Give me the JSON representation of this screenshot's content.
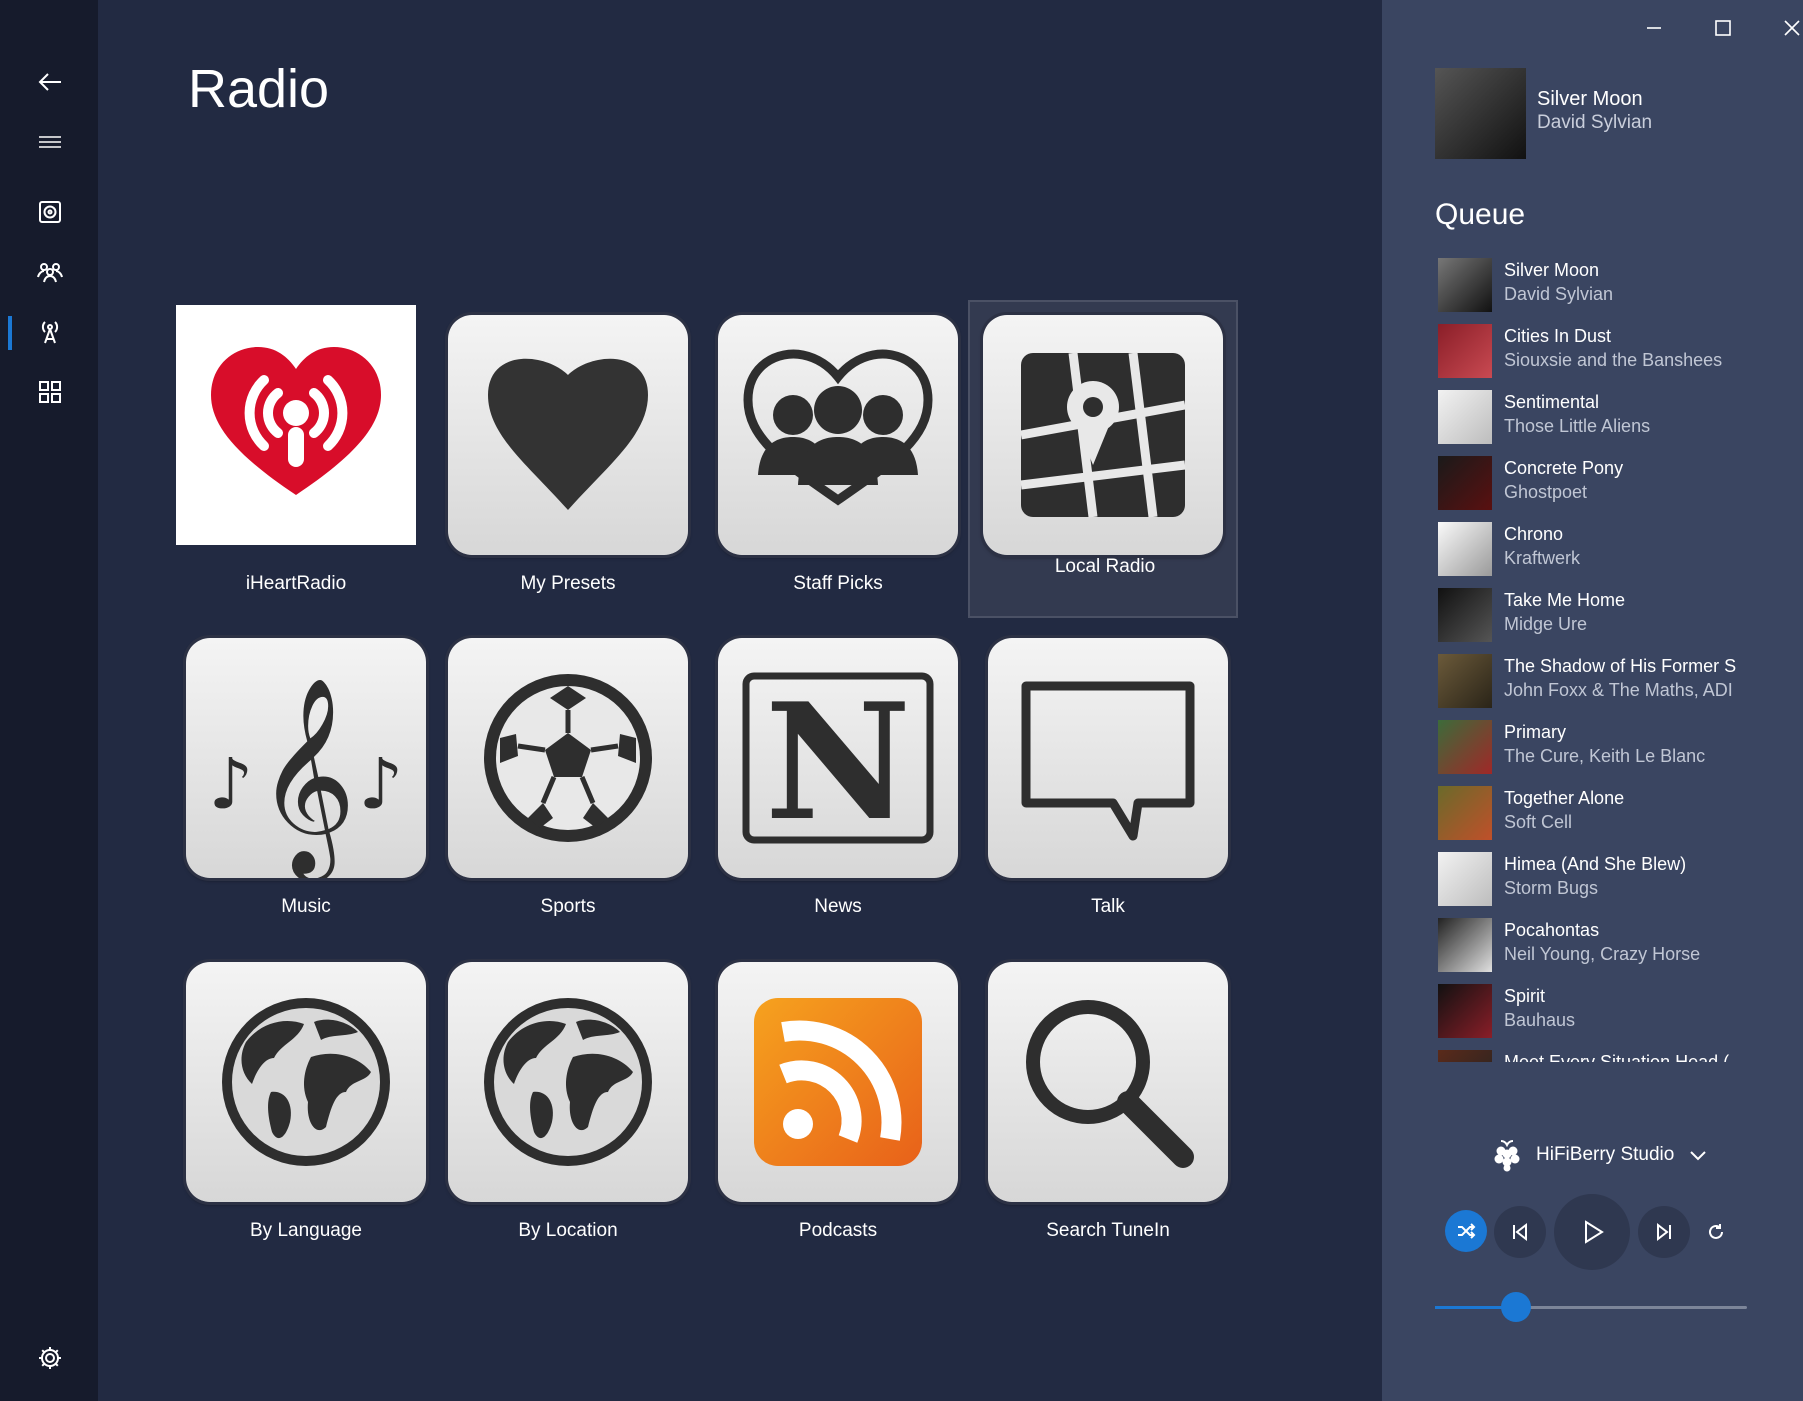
{
  "page": {
    "title": "Radio"
  },
  "nav": {
    "items": [
      {
        "icon": "back-arrow-icon"
      },
      {
        "icon": "hamburger-menu-icon"
      },
      {
        "icon": "speaker-icon"
      },
      {
        "icon": "people-group-icon"
      },
      {
        "icon": "radio-tower-icon",
        "selected": true
      },
      {
        "icon": "grid-icon"
      },
      {
        "icon": "gear-icon"
      }
    ],
    "accent": "#1b78d4"
  },
  "tiles": [
    {
      "label": "iHeartRadio",
      "icon": "iheartradio-logo"
    },
    {
      "label": "My Presets",
      "icon": "heart-icon"
    },
    {
      "label": "Staff Picks",
      "icon": "staff-people-icon"
    },
    {
      "label": "Local Radio",
      "icon": "map-pin-icon",
      "selected": true
    },
    {
      "label": "Music",
      "icon": "music-notes-icon"
    },
    {
      "label": "Sports",
      "icon": "soccer-ball-icon"
    },
    {
      "label": "News",
      "icon": "newspaper-icon"
    },
    {
      "label": "Talk",
      "icon": "speech-bubble-icon"
    },
    {
      "label": "By Language",
      "icon": "globe-icon"
    },
    {
      "label": "By Location",
      "icon": "globe-icon"
    },
    {
      "label": "Podcasts",
      "icon": "rss-icon"
    },
    {
      "label": "Search TuneIn",
      "icon": "search-icon"
    }
  ],
  "now_playing": {
    "title": "Silver Moon",
    "artist": "David Sylvian"
  },
  "queue": {
    "title": "Queue",
    "items": [
      {
        "title": "Silver Moon",
        "artist": "David Sylvian"
      },
      {
        "title": "Cities In Dust",
        "artist": "Siouxsie and the Banshees"
      },
      {
        "title": "Sentimental",
        "artist": "Those Little Aliens"
      },
      {
        "title": "Concrete Pony",
        "artist": "Ghostpoet"
      },
      {
        "title": "Chrono",
        "artist": "Kraftwerk"
      },
      {
        "title": "Take Me Home",
        "artist": "Midge Ure"
      },
      {
        "title": "The Shadow of His Former S",
        "artist": "John Foxx & The Maths, ADI"
      },
      {
        "title": "Primary",
        "artist": "The Cure, Keith Le Blanc"
      },
      {
        "title": "Together Alone",
        "artist": "Soft Cell"
      },
      {
        "title": "Himea (And She Blew)",
        "artist": "Storm Bugs"
      },
      {
        "title": "Pocahontas",
        "artist": "Neil Young, Crazy Horse"
      },
      {
        "title": "Spirit",
        "artist": "Bauhaus"
      },
      {
        "title": "Meet Every Situation Head (",
        "artist": ""
      }
    ]
  },
  "device": {
    "name": "HiFiBerry Studio",
    "icon": "raspberry-icon"
  },
  "controls": {
    "shuffle_on": true,
    "volume_fraction": 0.26
  },
  "colors": {
    "background": "#222a42",
    "nav": "#161b2c",
    "panel": "#3a4561",
    "accent": "#1b78d4",
    "iheart_red": "#d80d2a",
    "rss_orange": "#f08a1e"
  }
}
